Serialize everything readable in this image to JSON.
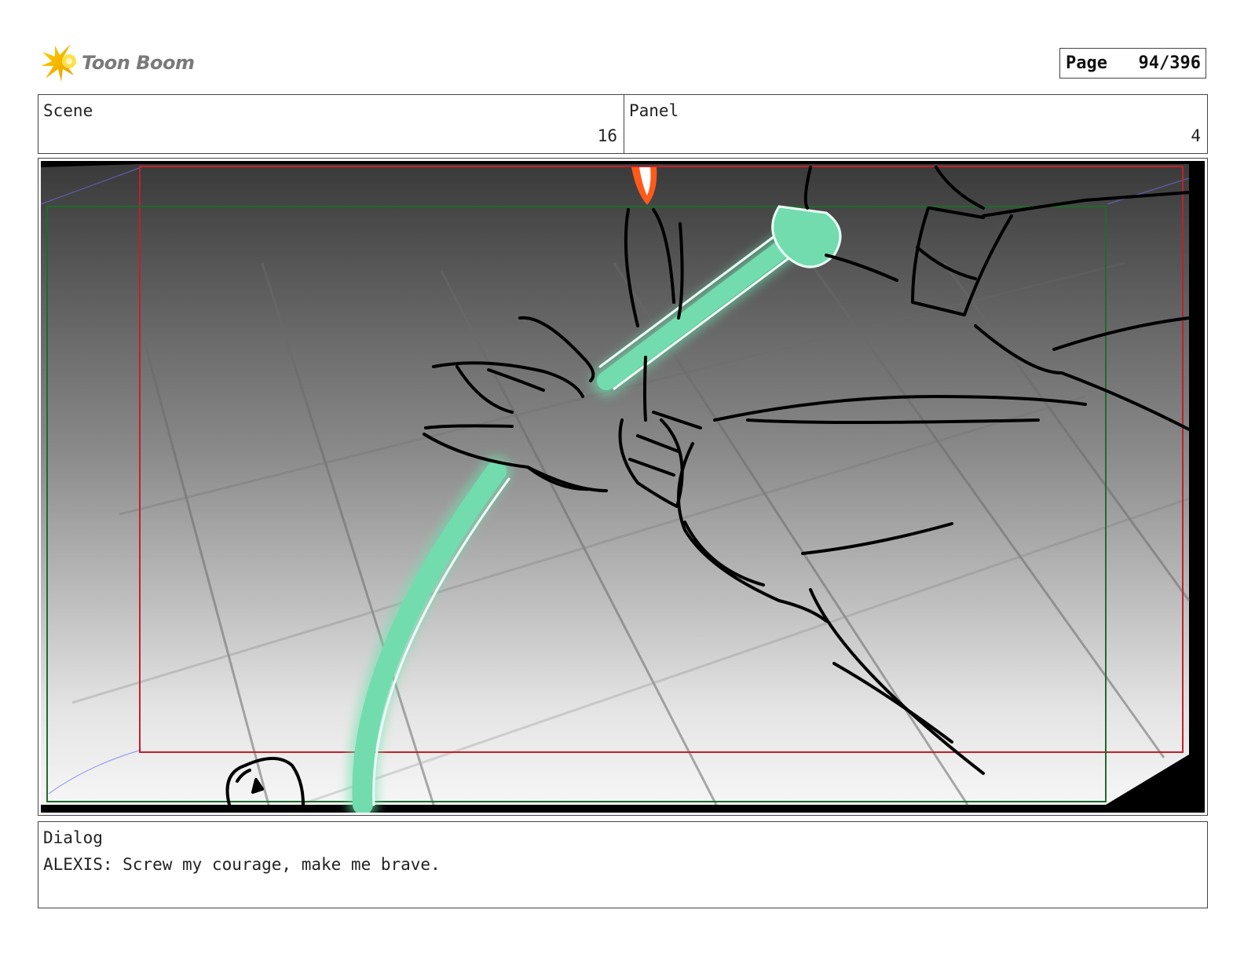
{
  "header": {
    "logo_text": "Toon Boom",
    "page_label": "Page",
    "page_number": "94/396"
  },
  "scene": {
    "label": "Scene",
    "value": "16"
  },
  "panel": {
    "label": "Panel",
    "value": "4"
  },
  "dialog": {
    "label": "Dialog",
    "text": "ALEXIS: Screw my courage, make me brave."
  },
  "colors": {
    "safe_frame": "#c0202a",
    "camera_frame": "#1e6b2a",
    "energy_glow": "#6fe0b0",
    "flame": "#ff5a1a",
    "logo_star": "#f5c400"
  }
}
